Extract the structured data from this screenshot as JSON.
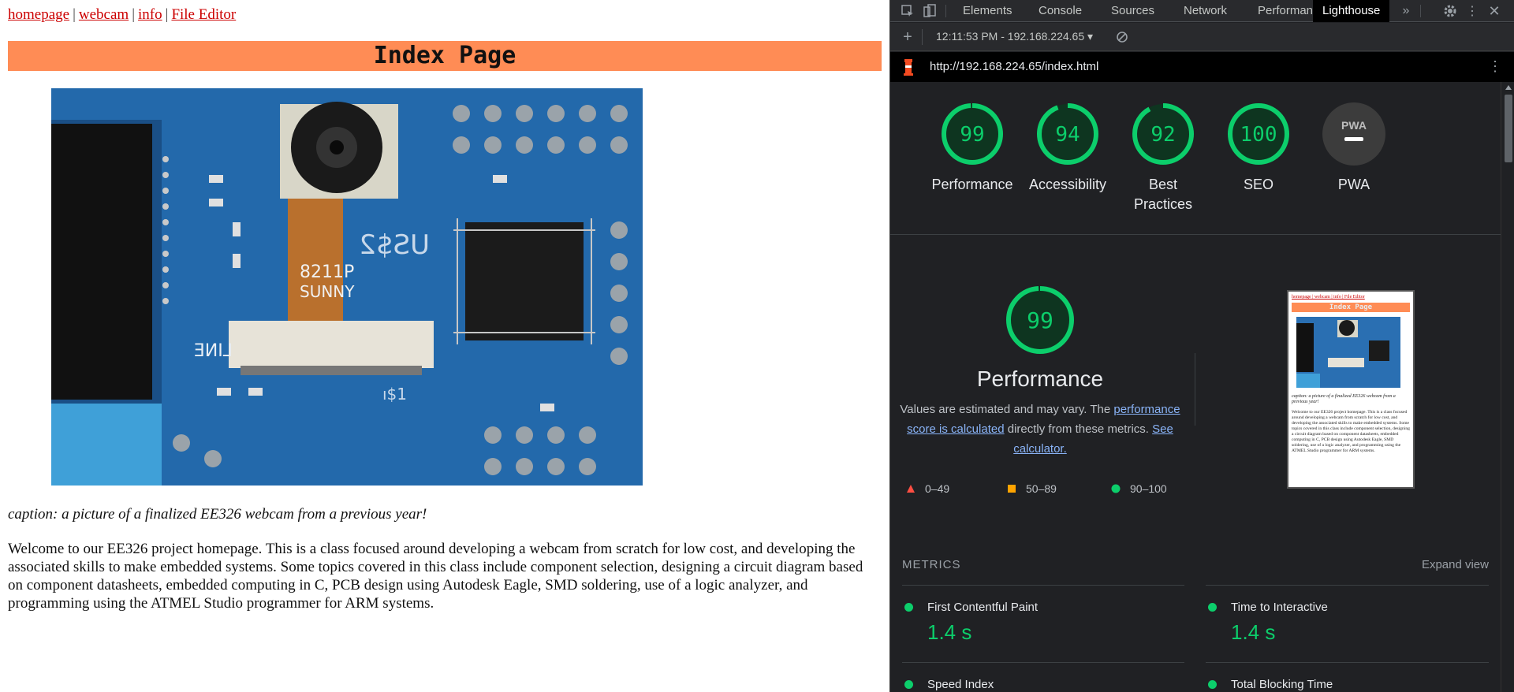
{
  "page": {
    "nav": [
      {
        "label": "homepage"
      },
      {
        "label": "webcam"
      },
      {
        "label": "info"
      },
      {
        "label": "File Editor"
      }
    ],
    "nav_separator": "|",
    "banner_color": "#ff8c55",
    "title": "Index Page",
    "photo_labels": {
      "chip": "8211P",
      "brand": "SUNNY",
      "silk_left": "LINE",
      "silk_right": "US$2",
      "silk_bottom": "ı$1"
    },
    "caption": "caption: a picture of a finalized EE326 webcam from a previous year!",
    "intro": "Welcome to our EE326 project homepage. This is a class focused around developing a webcam from scratch for low cost, and developing the associated skills to make embedded systems. Some topics covered in this class include component selection, designing a circuit diagram based on component datasheets, embedded computing in C, PCB design using Autodesk Eagle, SMD soldering, use of a logic analyzer, and programming using the ATMEL Studio programmer for ARM systems."
  },
  "devtools": {
    "tabs": [
      "Elements",
      "Console",
      "Sources",
      "Network",
      "Performance",
      "Lighthouse"
    ],
    "active_tab": "Lighthouse",
    "report_time": "12:11:53 PM - 192.168.224.65",
    "url": "http://192.168.224.65/index.html",
    "scores": [
      {
        "label": "Performance",
        "value": 99
      },
      {
        "label": "Accessibility",
        "value": 94
      },
      {
        "label": "Best Practices",
        "value": 92
      },
      {
        "label": "SEO",
        "value": 100
      },
      {
        "label": "PWA",
        "value": null,
        "badge": "PWA"
      }
    ],
    "performance": {
      "score": 99,
      "title": "Performance",
      "desc_1": "Values are estimated and may vary. The",
      "desc_link": "performance score is calculated",
      "desc_2": "directly from these metrics.",
      "calc_link": "See calculator."
    },
    "legend": [
      {
        "range": "0–49",
        "color": "#ff4e42",
        "shape": "triangle"
      },
      {
        "range": "50–89",
        "color": "#ffa400",
        "shape": "square"
      },
      {
        "range": "90–100",
        "color": "#0cce6b",
        "shape": "circle"
      }
    ],
    "metrics_title": "METRICS",
    "expand_label": "Expand view",
    "metrics": [
      {
        "name": "First Contentful Paint",
        "value": "1.4 s"
      },
      {
        "name": "Time to Interactive",
        "value": "1.4 s"
      },
      {
        "name": "Speed Index",
        "value": ""
      },
      {
        "name": "Total Blocking Time",
        "value": ""
      }
    ],
    "thumbnail": {
      "nav": "homepage | webcam | info | File Editor",
      "title": "Index Page",
      "caption": "caption: a picture of a finalized EE326 webcam from a previous year!",
      "text": "Welcome to our EE326 project homepage. This is a class focused around developing a webcam from scratch for low cost, and developing the associated skills to make embedded systems. Some topics covered in this class include component selection, designing a circuit diagram based on component datasheets, embedded computing in C, PCB design using Autodesk Eagle, SMD soldering, use of a logic analyzer, and programming using the ATMEL Studio programmer for ARM systems."
    },
    "colors": {
      "good": "#0cce6b",
      "bg": "#202124",
      "link": "#8ab4f8"
    },
    "icons": [
      "inspect-icon",
      "device-toggle-icon",
      "more-tabs-icon",
      "settings-icon",
      "kebab-menu-icon",
      "add-icon",
      "dropdown-icon",
      "clear-icon",
      "lighthouse-logo-icon",
      "url-menu-icon"
    ]
  }
}
